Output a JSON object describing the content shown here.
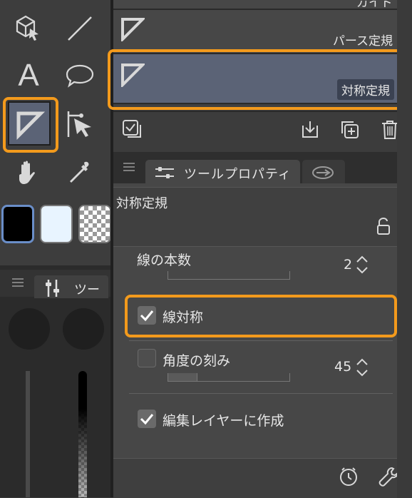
{
  "ruler_list": {
    "items": [
      {
        "label": "ガイド",
        "kind": "guide"
      },
      {
        "label": "パース定規",
        "kind": "perspective"
      },
      {
        "label": "対称定規",
        "kind": "symmetry",
        "selected": true
      }
    ]
  },
  "tabs": {
    "active_label": "ツールプロパティ",
    "secondary_label": "ツー"
  },
  "properties": {
    "tool_name": "対称定規",
    "lines_label": "線の本数",
    "lines_value": "2",
    "line_symmetry_label": "線対称",
    "line_symmetry_checked": true,
    "angle_step_label": "角度の刻み",
    "angle_step_value": "45",
    "angle_step_checked": false,
    "create_on_layer_label": "編集レイヤーに作成",
    "create_on_layer_checked": true
  },
  "left_tools": {
    "text_tool_glyph": "A",
    "colors": {
      "main": "#000000",
      "sub": "#e8f4ff"
    }
  },
  "theme": {
    "highlight": "#f39a1c",
    "selection": "#5b6376"
  }
}
